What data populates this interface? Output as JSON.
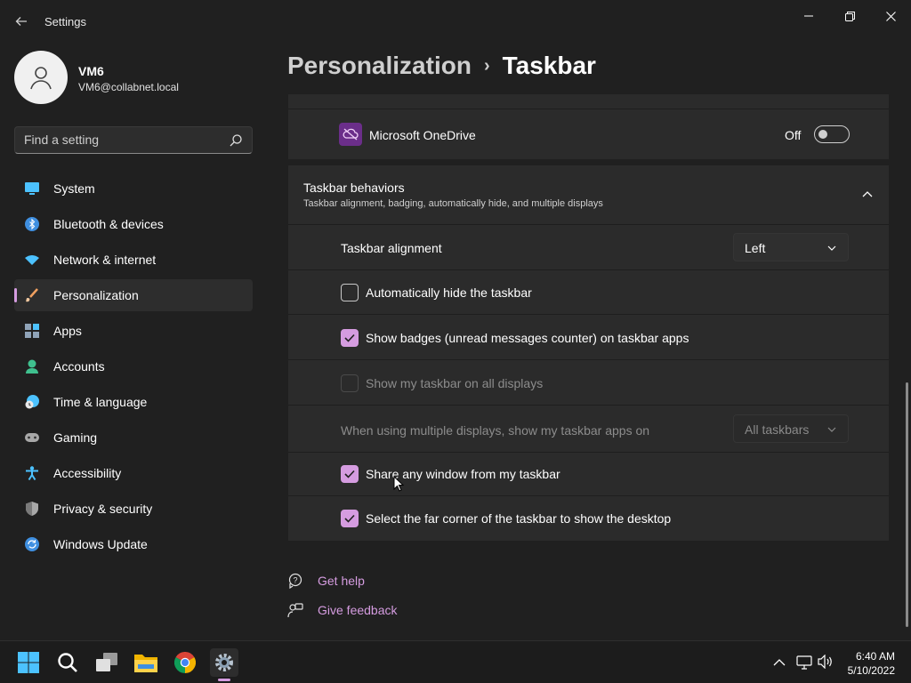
{
  "window": {
    "title": "Settings"
  },
  "profile": {
    "name": "VM6",
    "email": "VM6@collabnet.local"
  },
  "search": {
    "placeholder": "Find a setting"
  },
  "sidebar": {
    "items": [
      {
        "label": "System",
        "icon": "system-icon"
      },
      {
        "label": "Bluetooth & devices",
        "icon": "bluetooth-icon"
      },
      {
        "label": "Network & internet",
        "icon": "wifi-icon"
      },
      {
        "label": "Personalization",
        "icon": "brush-icon",
        "active": true
      },
      {
        "label": "Apps",
        "icon": "apps-icon"
      },
      {
        "label": "Accounts",
        "icon": "accounts-icon"
      },
      {
        "label": "Time & language",
        "icon": "clock-globe-icon"
      },
      {
        "label": "Gaming",
        "icon": "gamepad-icon"
      },
      {
        "label": "Accessibility",
        "icon": "accessibility-icon"
      },
      {
        "label": "Privacy & security",
        "icon": "shield-icon"
      },
      {
        "label": "Windows Update",
        "icon": "update-icon"
      }
    ]
  },
  "breadcrumb": {
    "parent": "Personalization",
    "separator": "›",
    "current": "Taskbar"
  },
  "onedrive": {
    "label": "Microsoft OneDrive",
    "state_label": "Off",
    "on": false
  },
  "behaviors": {
    "title": "Taskbar behaviors",
    "subtitle": "Taskbar alignment, badging, automatically hide, and multiple displays",
    "expanded": true,
    "alignment": {
      "label": "Taskbar alignment",
      "value": "Left"
    },
    "auto_hide": {
      "label": "Automatically hide the taskbar",
      "checked": false
    },
    "badges": {
      "label": "Show badges (unread messages counter) on taskbar apps",
      "checked": true
    },
    "all_displays": {
      "label": "Show my taskbar on all displays",
      "checked": false,
      "disabled": true
    },
    "multi_display": {
      "label": "When using multiple displays, show my taskbar apps on",
      "value": "All taskbars",
      "disabled": true
    },
    "share_window": {
      "label": "Share any window from my taskbar",
      "checked": true
    },
    "far_corner": {
      "label": "Select the far corner of the taskbar to show the desktop",
      "checked": true
    }
  },
  "help": {
    "get_help": "Get help",
    "give_feedback": "Give feedback"
  },
  "taskbar": {
    "apps": [
      "start-icon",
      "search-icon",
      "task-view-icon",
      "file-explorer-icon",
      "chrome-icon",
      "settings-icon"
    ],
    "time": "6:40 AM",
    "date": "5/10/2022"
  },
  "colors": {
    "accent": "#d59ce0",
    "background": "#202020",
    "card": "#2b2b2b"
  }
}
